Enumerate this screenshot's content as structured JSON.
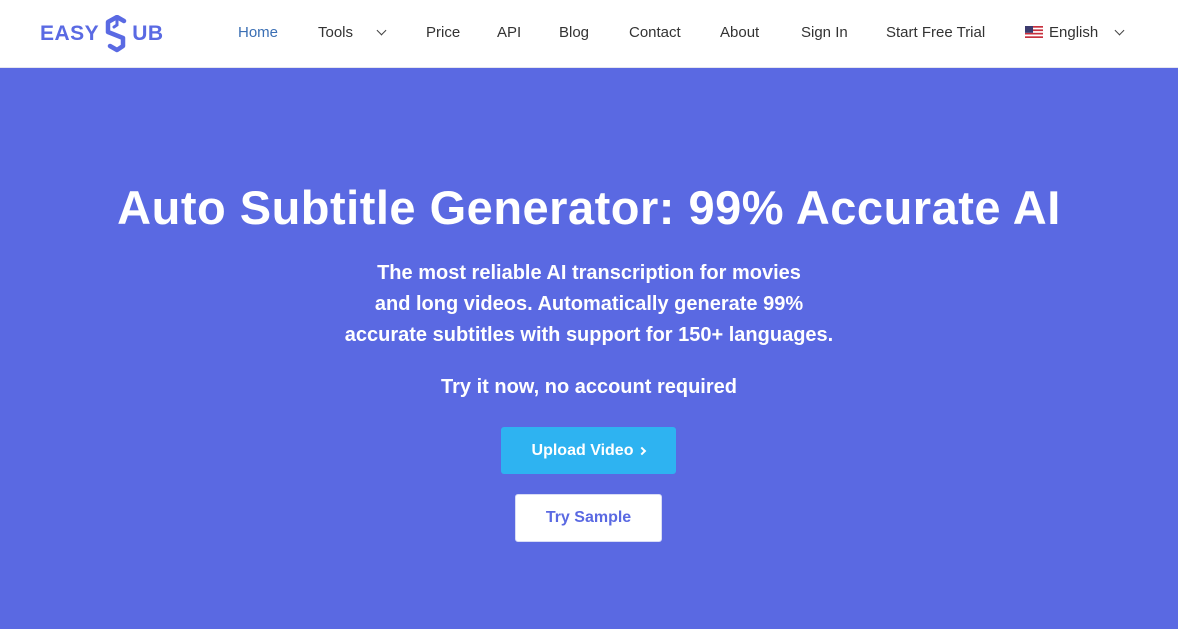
{
  "brand": {
    "name_left": "EASY",
    "name_right": "UB",
    "color": "#5a6ae3",
    "icon": "s-logo-icon"
  },
  "nav": {
    "items": [
      {
        "label": "Home",
        "active": true
      },
      {
        "label": "Tools",
        "has_dropdown": true
      },
      {
        "label": "Price"
      },
      {
        "label": "API"
      },
      {
        "label": "Blog"
      },
      {
        "label": "Contact"
      },
      {
        "label": "About"
      },
      {
        "label": "Sign In"
      },
      {
        "label": "Start Free Trial"
      }
    ],
    "language": {
      "label": "English",
      "flag": "us-flag-icon",
      "has_dropdown": true
    },
    "active_color": "#3b6fb4"
  },
  "hero": {
    "background": "#5a69e2",
    "title": "Auto Subtitle Generator: 99% Accurate AI",
    "description_lines": [
      "The most reliable AI transcription for movies",
      "and long videos. Automatically generate 99%",
      "accurate subtitles with support for 150+ languages."
    ],
    "try_text": "Try it now, no account required",
    "upload_button": {
      "label": "Upload Video",
      "color": "#2eb3f1"
    },
    "sample_button": {
      "label": "Try Sample"
    }
  }
}
